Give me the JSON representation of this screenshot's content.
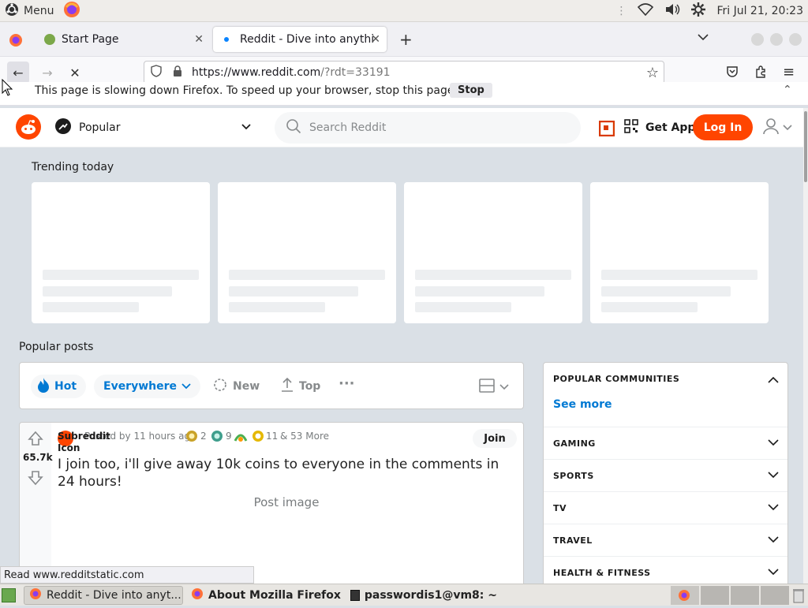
{
  "os": {
    "menu_label": "Menu",
    "datetime": "Fri Jul 21, 20:23"
  },
  "browser": {
    "tabs": [
      {
        "title": "Start Page"
      },
      {
        "title": "Reddit - Dive into anythin"
      }
    ],
    "url_main": "https://www.reddit.com",
    "url_rest": "/?rdt=33191",
    "notice_text": "This page is slowing down Firefox. To speed up your browser, stop this page.",
    "notice_button": "Stop",
    "status_text": "Read www.redditstatic.com"
  },
  "reddit": {
    "feed_selector": "Popular",
    "search_placeholder": "Search Reddit",
    "get_app": "Get App",
    "login": "Log In",
    "trending_title": "Trending today",
    "popular_posts_title": "Popular posts",
    "sort": {
      "hot": "Hot",
      "everywhere": "Everywhere",
      "new": "New",
      "top": "Top"
    },
    "post": {
      "votes": "65.7k",
      "subreddit_icon_alt": "Subreddit Icon",
      "posted": "Posted by 11 hours ago",
      "award1": "2",
      "award2": "9",
      "award3": "11",
      "more_awards": "& 53 More",
      "join": "Join",
      "title": "I join too, i'll give away 10k coins to everyone in the comments in 24 hours!",
      "image_alt": "Post image"
    },
    "sidebar": {
      "heading": "POPULAR COMMUNITIES",
      "see_more": "See more",
      "items": [
        "GAMING",
        "SPORTS",
        "TV",
        "TRAVEL",
        "HEALTH & FITNESS"
      ]
    },
    "accent": "#ff4500",
    "link_blue": "#0079d3"
  },
  "taskbar": {
    "items": [
      {
        "label": "Reddit - Dive into anyt..."
      },
      {
        "label": "About Mozilla Firefox"
      },
      {
        "label": "passwordis1@vm8: ~"
      }
    ]
  }
}
